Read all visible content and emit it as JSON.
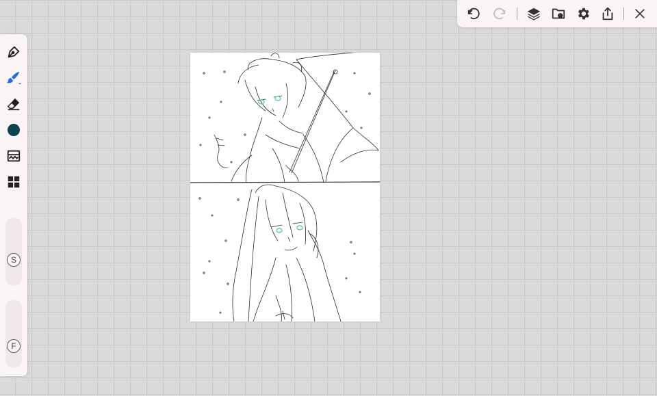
{
  "toolbar": {
    "icons": [
      "undo-icon",
      "redo-icon",
      "layers-icon",
      "import-icon",
      "gear-icon",
      "share-icon",
      "close-icon"
    ]
  },
  "tools": {
    "icons": [
      "pen-icon",
      "brush-icon",
      "eraser-icon",
      "color-icon",
      "filter-icon",
      "materials-icon"
    ],
    "current_color": "#0d4350"
  },
  "sliders": {
    "size_label": "S",
    "flow_label": "F"
  },
  "colors": {
    "panel": "#fbf4f6",
    "accent_brush": "#1e6ee8",
    "eye_tint": "#5ecab5",
    "canvas_bg": "#d9d9db"
  }
}
